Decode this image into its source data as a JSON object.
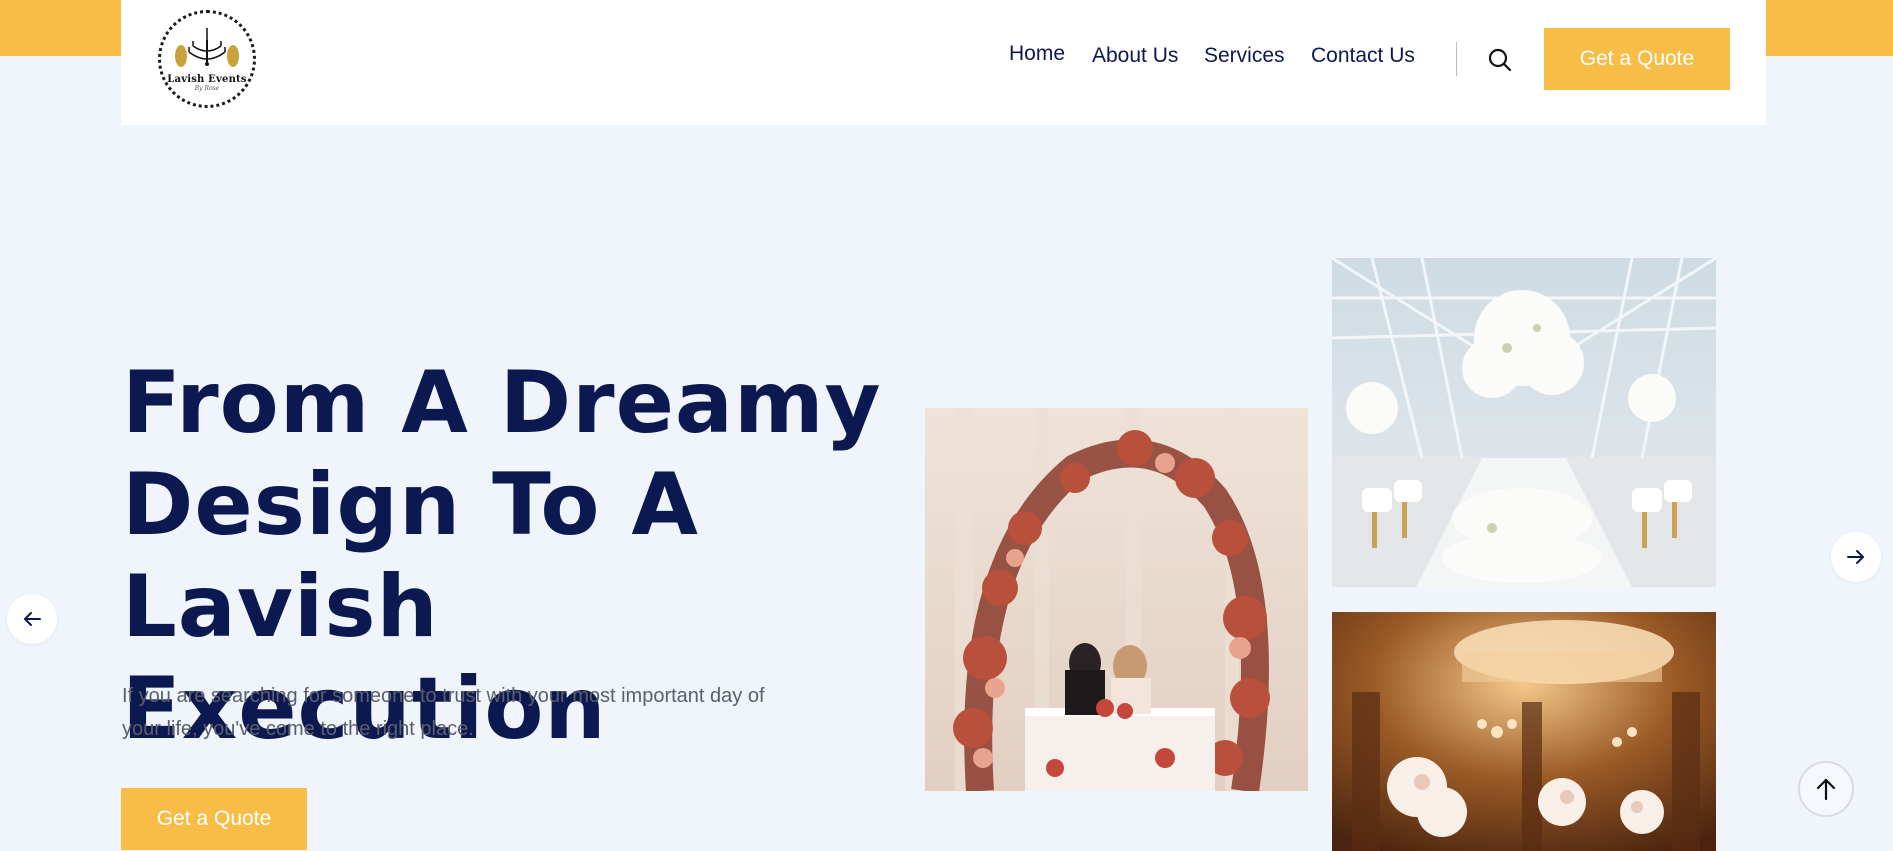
{
  "header": {
    "logo": {
      "text": "Lavish Events",
      "subtext": "By Rose"
    },
    "nav": [
      {
        "label": "Home"
      },
      {
        "label": "About Us"
      },
      {
        "label": "Services"
      },
      {
        "label": "Contact Us"
      }
    ],
    "search_icon": "search-icon",
    "cta_label": "Get a Quote"
  },
  "hero": {
    "title_lines": [
      "From A Dreamy",
      "Design To A",
      "Lavish Execution"
    ],
    "description_lines": [
      "If you are searching for someone to trust with your most important day of",
      "your life, you've come to the right place."
    ],
    "cta_label": "Get a Quote"
  },
  "gallery": [
    {
      "name": "floral-arch-photo"
    },
    {
      "name": "glass-venue-photo"
    },
    {
      "name": "palace-hall-photo"
    }
  ],
  "controls": {
    "prev_icon": "arrow-left-icon",
    "next_icon": "arrow-right-icon",
    "scroll_top_icon": "arrow-up-icon"
  },
  "colors": {
    "accent": "#f8bd47",
    "heading": "#0c1850",
    "page_background": "#f0f5fc",
    "body_text": "#5b5f6b"
  }
}
